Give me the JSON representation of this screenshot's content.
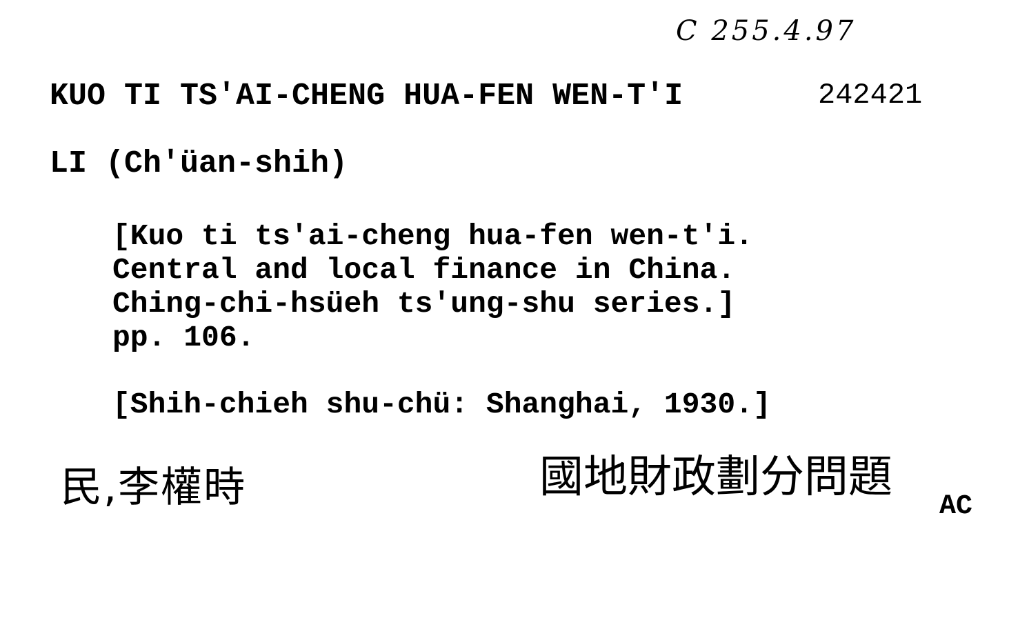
{
  "card": {
    "classmark": "C 255.4.97",
    "accession_number": "242421",
    "title": "KUO TI TS'AI-CHENG HUA-FEN WEN-T'I",
    "author": "LI (Ch'üan-shih)",
    "description_lines": [
      "[Kuo ti ts'ai-cheng hua-fen wen-t'i.",
      "Central and local finance in China.",
      "Ching-chi-hsüeh ts'ung-shu series.]",
      "pp. 106."
    ],
    "imprint": "[Shih-chieh shu-chü: Shanghai, 1930.]",
    "chinese_author": "民,李權時",
    "chinese_title": "國地財政劃分問題",
    "collection_code": "AC"
  }
}
